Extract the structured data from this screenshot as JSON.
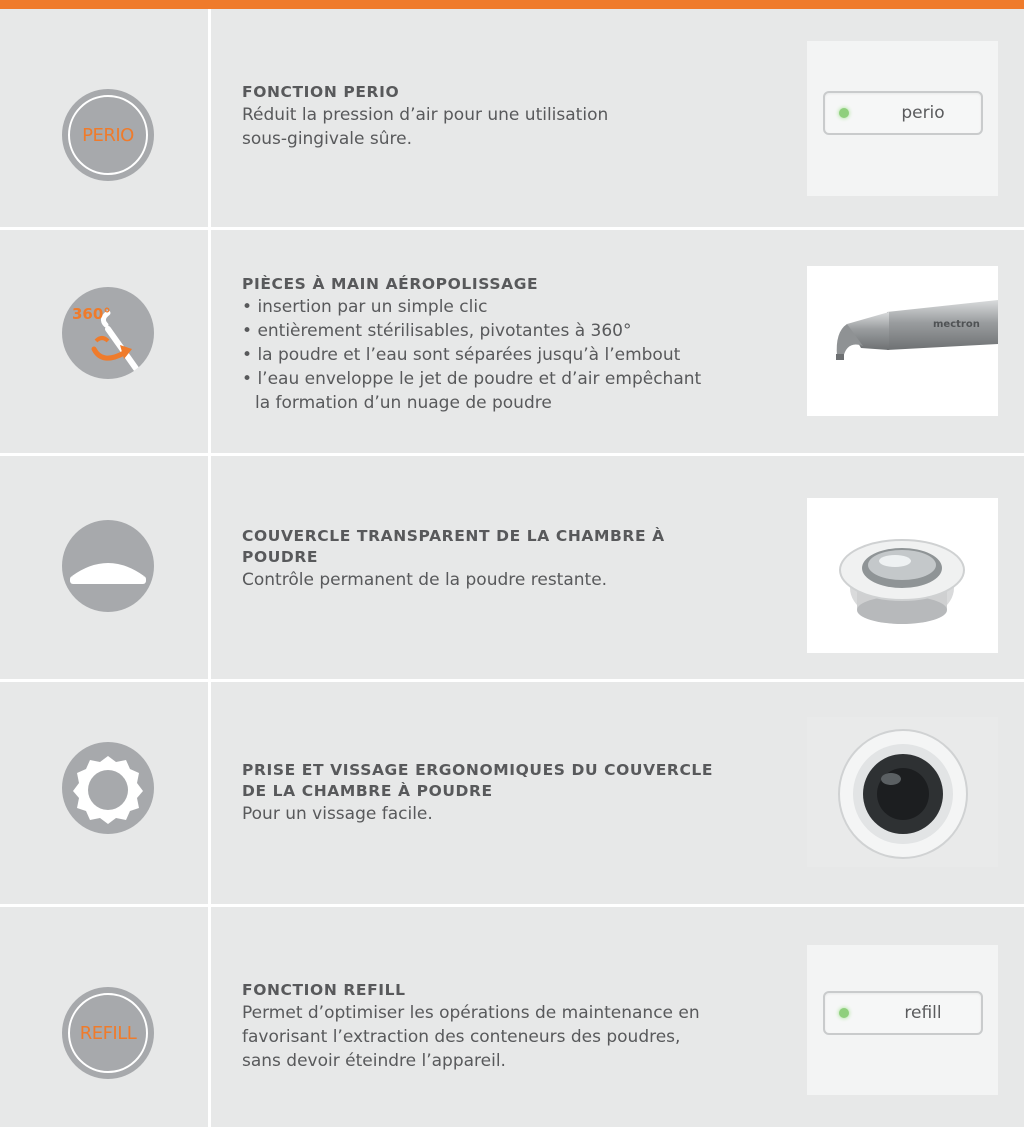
{
  "rows": [
    {
      "icon_text": "PERIO",
      "title": "FONCTION PERIO",
      "desc_lines": [
        "Réduit la pression d’air pour une utilisation",
        "sous-gingivale sûre."
      ],
      "panel_label": "perio"
    },
    {
      "icon_text": "360°",
      "title": "PIÈCES À MAIN AÉROPOLISSAGE",
      "bullets": [
        "insertion par un simple clic",
        "entièrement stérilisables, pivotantes à 360°",
        "la poudre et l’eau sont séparées jusqu’à l’embout",
        "l’eau enveloppe le jet de poudre et d’air empêchant la formation d’un nuage de poudre"
      ],
      "brand_text": "mectron"
    },
    {
      "title_lines": [
        "COUVERCLE TRANSPARENT DE LA CHAMBRE À",
        "POUDRE"
      ],
      "desc": "Contrôle permanent de la poudre restante."
    },
    {
      "title_lines": [
        "PRISE ET VISSAGE ERGONOMIQUES DU COUVERCLE",
        "DE LA CHAMBRE À POUDRE"
      ],
      "desc": "Pour un vissage facile."
    },
    {
      "icon_text": "REFILL",
      "title": "FONCTION REFILL",
      "desc_lines": [
        "Permet d’optimiser les opérations de maintenance en",
        "favorisant l’extraction des conteneurs des poudres,",
        "sans devoir éteindre l’appareil."
      ],
      "panel_label": "refill"
    }
  ],
  "colors": {
    "accent": "#ef7b2b",
    "background": "#e7e8e8",
    "icon_gray": "#a7a9ac",
    "text": "#58595b",
    "led_green": "#8fcf7d"
  },
  "icons": [
    "perio-badge-icon",
    "rotation-360-icon",
    "dome-cover-icon",
    "gear-ring-icon",
    "refill-badge-icon"
  ]
}
